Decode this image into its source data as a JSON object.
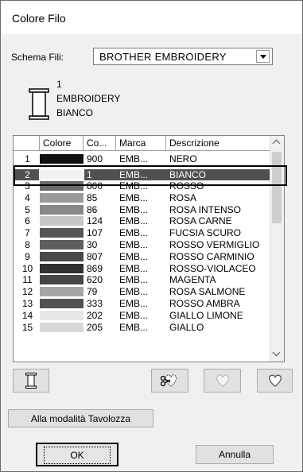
{
  "dialog": {
    "title": "Colore Filo",
    "scheme_label": "Schema Fili:",
    "scheme_value": "BROTHER EMBROIDERY",
    "selected_info": {
      "line1": "1",
      "line2": "EMBROIDERY",
      "line3": "BIANCO"
    },
    "columns": [
      "Colore",
      "Co...",
      "Marca",
      "Descrizione"
    ],
    "rows": [
      {
        "n": "1",
        "color": "#111111",
        "code": "900",
        "brand": "EMB...",
        "desc": "NERO"
      },
      {
        "n": "2",
        "color": "#f2f2f2",
        "code": "1",
        "brand": "EMB...",
        "desc": "BIANCO"
      },
      {
        "n": "3",
        "color": "#6a6a6a",
        "code": "800",
        "brand": "EMB...",
        "desc": "ROSSO"
      },
      {
        "n": "4",
        "color": "#9a9a9a",
        "code": "85",
        "brand": "EMB...",
        "desc": "ROSA"
      },
      {
        "n": "5",
        "color": "#888888",
        "code": "86",
        "brand": "EMB...",
        "desc": "ROSA INTENSO"
      },
      {
        "n": "6",
        "color": "#c6c6c6",
        "code": "124",
        "brand": "EMB...",
        "desc": "ROSA CARNE"
      },
      {
        "n": "7",
        "color": "#555555",
        "code": "107",
        "brand": "EMB...",
        "desc": "FUCSIA SCURO"
      },
      {
        "n": "8",
        "color": "#5e5e5e",
        "code": "30",
        "brand": "EMB...",
        "desc": "ROSSO VERMIGLIO"
      },
      {
        "n": "9",
        "color": "#494949",
        "code": "807",
        "brand": "EMB...",
        "desc": "ROSSO CARMINIO"
      },
      {
        "n": "10",
        "color": "#303030",
        "code": "869",
        "brand": "EMB...",
        "desc": "ROSSO-VIOLACEO"
      },
      {
        "n": "11",
        "color": "#454545",
        "code": "620",
        "brand": "EMB...",
        "desc": "MAGENTA"
      },
      {
        "n": "12",
        "color": "#a5a5a5",
        "code": "79",
        "brand": "EMB...",
        "desc": "ROSA SALMONE"
      },
      {
        "n": "13",
        "color": "#525252",
        "code": "333",
        "brand": "EMB...",
        "desc": "ROSSO AMBRA"
      },
      {
        "n": "14",
        "color": "#e6e6e6",
        "code": "202",
        "brand": "EMB...",
        "desc": "GIALLO LIMONE"
      },
      {
        "n": "15",
        "color": "#d8d8d8",
        "code": "205",
        "brand": "EMB...",
        "desc": "GIALLO"
      }
    ],
    "selected_row": "2",
    "tools": {
      "spool": "spool-icon",
      "cut": "scissors-heart-icon",
      "fav_add": "heart-outline-icon",
      "fav": "heart-icon"
    },
    "palette_button": "Alla modalità Tavolozza",
    "ok_button": "OK",
    "cancel_button": "Annulla"
  }
}
